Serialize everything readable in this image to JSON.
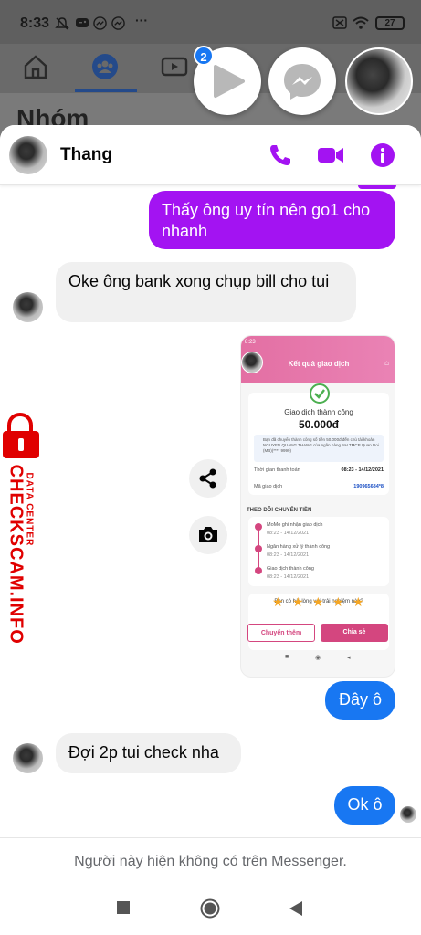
{
  "status_bar": {
    "time": "8:33",
    "icons_left": [
      "mute-icon",
      "gamepad-icon",
      "messenger-icon",
      "messenger-icon"
    ],
    "more": "···",
    "battery": "27"
  },
  "background_app": {
    "title": "Nhóm",
    "tabs": [
      "home-icon",
      "groups-icon",
      "video-icon"
    ]
  },
  "chat_heads": {
    "badge_count": "2",
    "items": [
      "video-play-icon",
      "messenger-icon",
      "user-avatar"
    ]
  },
  "header": {
    "contact_name": "Thang",
    "actions": [
      "phone-icon",
      "video-call-icon",
      "info-icon"
    ],
    "accent_color": "#a313f2"
  },
  "messages": [
    {
      "side": "out",
      "text": "Thấy ông uy tín nên go1 cho nhanh"
    },
    {
      "side": "in",
      "text": "Oke ông bank xong chụp bill cho tui"
    },
    {
      "side": "out",
      "type": "image"
    },
    {
      "side": "out",
      "text": "Đây ô"
    },
    {
      "side": "in",
      "text": "Đợi 2p tui check nha"
    },
    {
      "side": "out",
      "text": "Ok ô"
    }
  ],
  "receipt": {
    "status_time": "8:23",
    "header_title": "Kết quả giao dịch",
    "success_label": "Giao dịch thành công",
    "amount": "50.000đ",
    "notice": "Bạn đã chuyển thành công số tiền 50.000đ đến chủ tài khoản NGUYEN QUANG THANG của ngân hàng NH TMCP Quan Doi (MB)(**** 9999)",
    "time_label": "Thời gian thanh toán",
    "time_value": "08:23 - 14/12/2021",
    "code_label": "Mã giao dịch",
    "code_value": "190965684*8",
    "tracking_title": "THEO DÕI CHUYỂN TIỀN",
    "steps": [
      {
        "label": "MoMo ghi nhận giao dịch",
        "time": "08:23 - 14/12/2021"
      },
      {
        "label": "Ngân hàng xử lý thành công",
        "time": "08:23 - 14/12/2021"
      },
      {
        "label": "Giao dịch thành công",
        "time": "08:23 - 14/12/2021"
      }
    ],
    "rating_question": "Bạn có hài lòng với trải nghiệm này?",
    "stars": 5,
    "btn_transfer_more": "Chuyển thêm",
    "btn_share": "Chia sẻ"
  },
  "image_actions": [
    "share-icon",
    "camera-icon"
  ],
  "watermark": {
    "line1": "DATA CENTER",
    "line2": "CHECKSCAM.INFO"
  },
  "footer_note": "Người này hiện không có trên Messenger.",
  "nav_bar": [
    "recents-button",
    "home-button",
    "back-button"
  ]
}
